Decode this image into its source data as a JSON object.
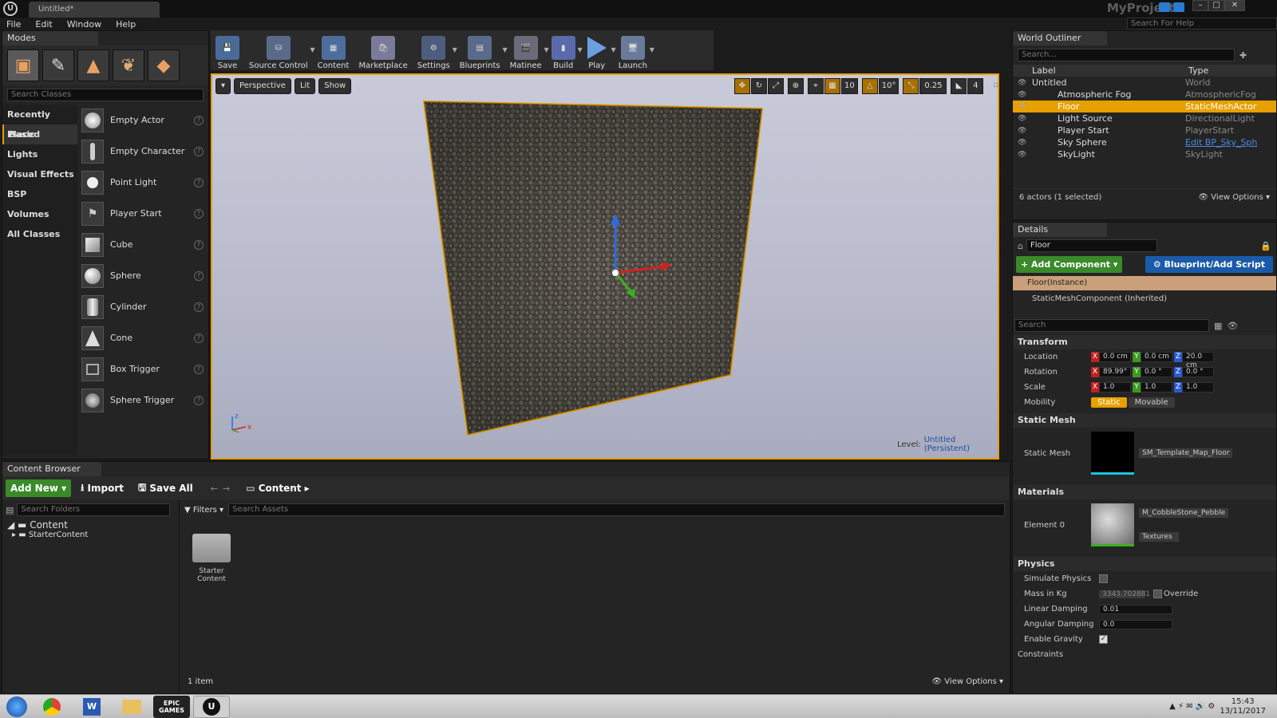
{
  "window": {
    "tab_title": "Untitled*",
    "project": "MyProject",
    "help_placeholder": "Search For Help"
  },
  "menu": [
    "File",
    "Edit",
    "Window",
    "Help"
  ],
  "modes": {
    "tab": "Modes",
    "search_placeholder": "Search Classes",
    "categories": [
      "Recently Placed",
      "Basic",
      "Lights",
      "Visual Effects",
      "BSP",
      "Volumes",
      "All Classes"
    ],
    "classes": [
      "Empty Actor",
      "Empty Character",
      "Point Light",
      "Player Start",
      "Cube",
      "Sphere",
      "Cylinder",
      "Cone",
      "Box Trigger",
      "Sphere Trigger"
    ]
  },
  "toolbar": [
    "Save",
    "Source Control",
    "Content",
    "Marketplace",
    "Settings",
    "Blueprints",
    "Matinee",
    "Build",
    "Play",
    "Launch"
  ],
  "viewport": {
    "perspective": "Perspective",
    "lit": "Lit",
    "show": "Show",
    "grid_snap": "10",
    "rot_snap": "10°",
    "scale_snap": "0.25",
    "cam_speed": "4",
    "level_label": "Level:",
    "level_name": "Untitled (Persistent)"
  },
  "outliner": {
    "tab": "World Outliner",
    "search_placeholder": "Search...",
    "col_label": "Label",
    "col_type": "Type",
    "rows": [
      {
        "label": "Untitled",
        "type": "World"
      },
      {
        "label": "Atmospheric Fog",
        "type": "AtmosphericFog"
      },
      {
        "label": "Floor",
        "type": "StaticMeshActor"
      },
      {
        "label": "Light Source",
        "type": "DirectionalLight"
      },
      {
        "label": "Player Start",
        "type": "PlayerStart"
      },
      {
        "label": "Sky Sphere",
        "type": "Edit BP_Sky_Sph"
      },
      {
        "label": "SkyLight",
        "type": "SkyLight"
      }
    ],
    "status": "6 actors (1 selected)",
    "view_options": "View Options"
  },
  "details": {
    "tab": "Details",
    "name": "Floor",
    "add_component": "Add Component",
    "blueprint": "Blueprint/Add Script",
    "instance": "Floor(Instance)",
    "component": "StaticMeshComponent (Inherited)",
    "search_placeholder": "Search",
    "transform": "Transform",
    "location_label": "Location",
    "location": [
      "0.0 cm",
      "0.0 cm",
      "20.0 cm"
    ],
    "rotation_label": "Rotation",
    "rotation": [
      "89.99°",
      "0.0 °",
      "0.0 °"
    ],
    "scale_label": "Scale",
    "scale": [
      "1.0",
      "1.0",
      "1.0"
    ],
    "mobility_label": "Mobility",
    "mobility_static": "Static",
    "mobility_movable": "Movable",
    "static_mesh_section": "Static Mesh",
    "static_mesh_label": "Static Mesh",
    "static_mesh": "SM_Template_Map_Floor",
    "materials_section": "Materials",
    "element_label": "Element 0",
    "material": "M_CobbleStone_Pebble",
    "textures": "Textures",
    "physics_section": "Physics",
    "simulate_physics": "Simulate Physics",
    "mass_label": "Mass in Kg",
    "mass": "3343.702881",
    "override": "Override",
    "linear_damping_label": "Linear Damping",
    "linear_damping": "0.01",
    "angular_damping_label": "Angular Damping",
    "angular_damping": "0.0",
    "enable_gravity": "Enable Gravity",
    "constraints": "Constraints"
  },
  "content": {
    "tab": "Content Browser",
    "add_new": "Add New",
    "import": "Import",
    "save_all": "Save All",
    "path": "Content",
    "folder_search": "Search Folders",
    "filters": "Filters",
    "asset_search": "Search Assets",
    "tree_root": "Content",
    "tree_child": "StarterContent",
    "asset_name": "Starter Content",
    "item_count": "1 item",
    "view_options": "View Options"
  },
  "taskbar": {
    "time": "15:43",
    "date": "13/11/2017",
    "epic": "EPIC GAMES"
  }
}
